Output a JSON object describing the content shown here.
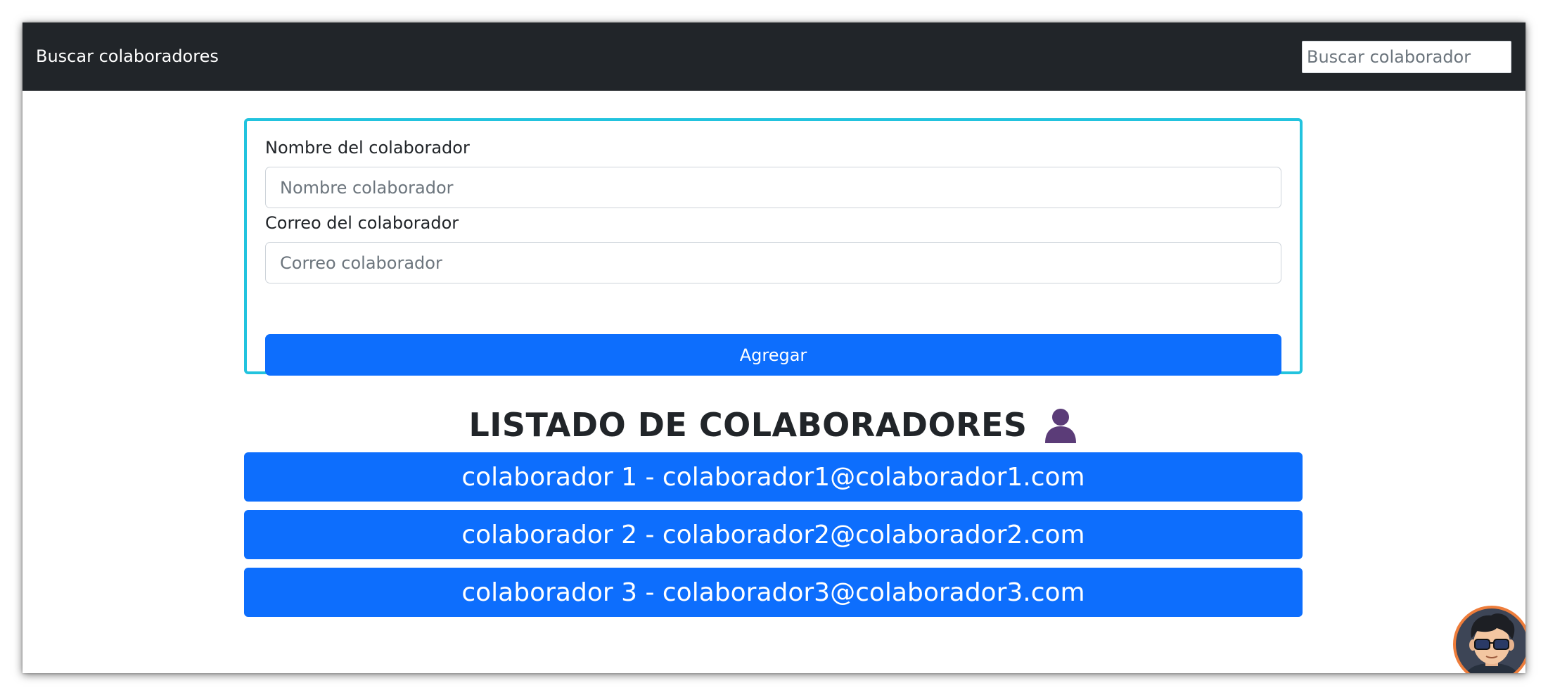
{
  "navbar": {
    "brand": "Buscar colaboradores",
    "search_placeholder": "Buscar colaborador"
  },
  "form": {
    "name_label": "Nombre del colaborador",
    "name_placeholder": "Nombre colaborador",
    "email_label": "Correo del colaborador",
    "email_placeholder": "Correo colaborador",
    "submit_label": "Agregar"
  },
  "list": {
    "title": "LISTADO DE COLABORADORES",
    "title_icon": "person-icon",
    "items": [
      {
        "label": "colaborador 1 - colaborador1@colaborador1.com"
      },
      {
        "label": "colaborador 2 - colaborador2@colaborador2.com"
      },
      {
        "label": "colaborador 3 - colaborador3@colaborador3.com"
      }
    ]
  },
  "avatar": {
    "icon": "avatar-icon"
  },
  "colors": {
    "navbar_bg": "#212529",
    "primary": "#0d6efd",
    "card_border": "#22c3de",
    "person_icon": "#5b3c78",
    "avatar_ring": "#ee7d3b"
  }
}
